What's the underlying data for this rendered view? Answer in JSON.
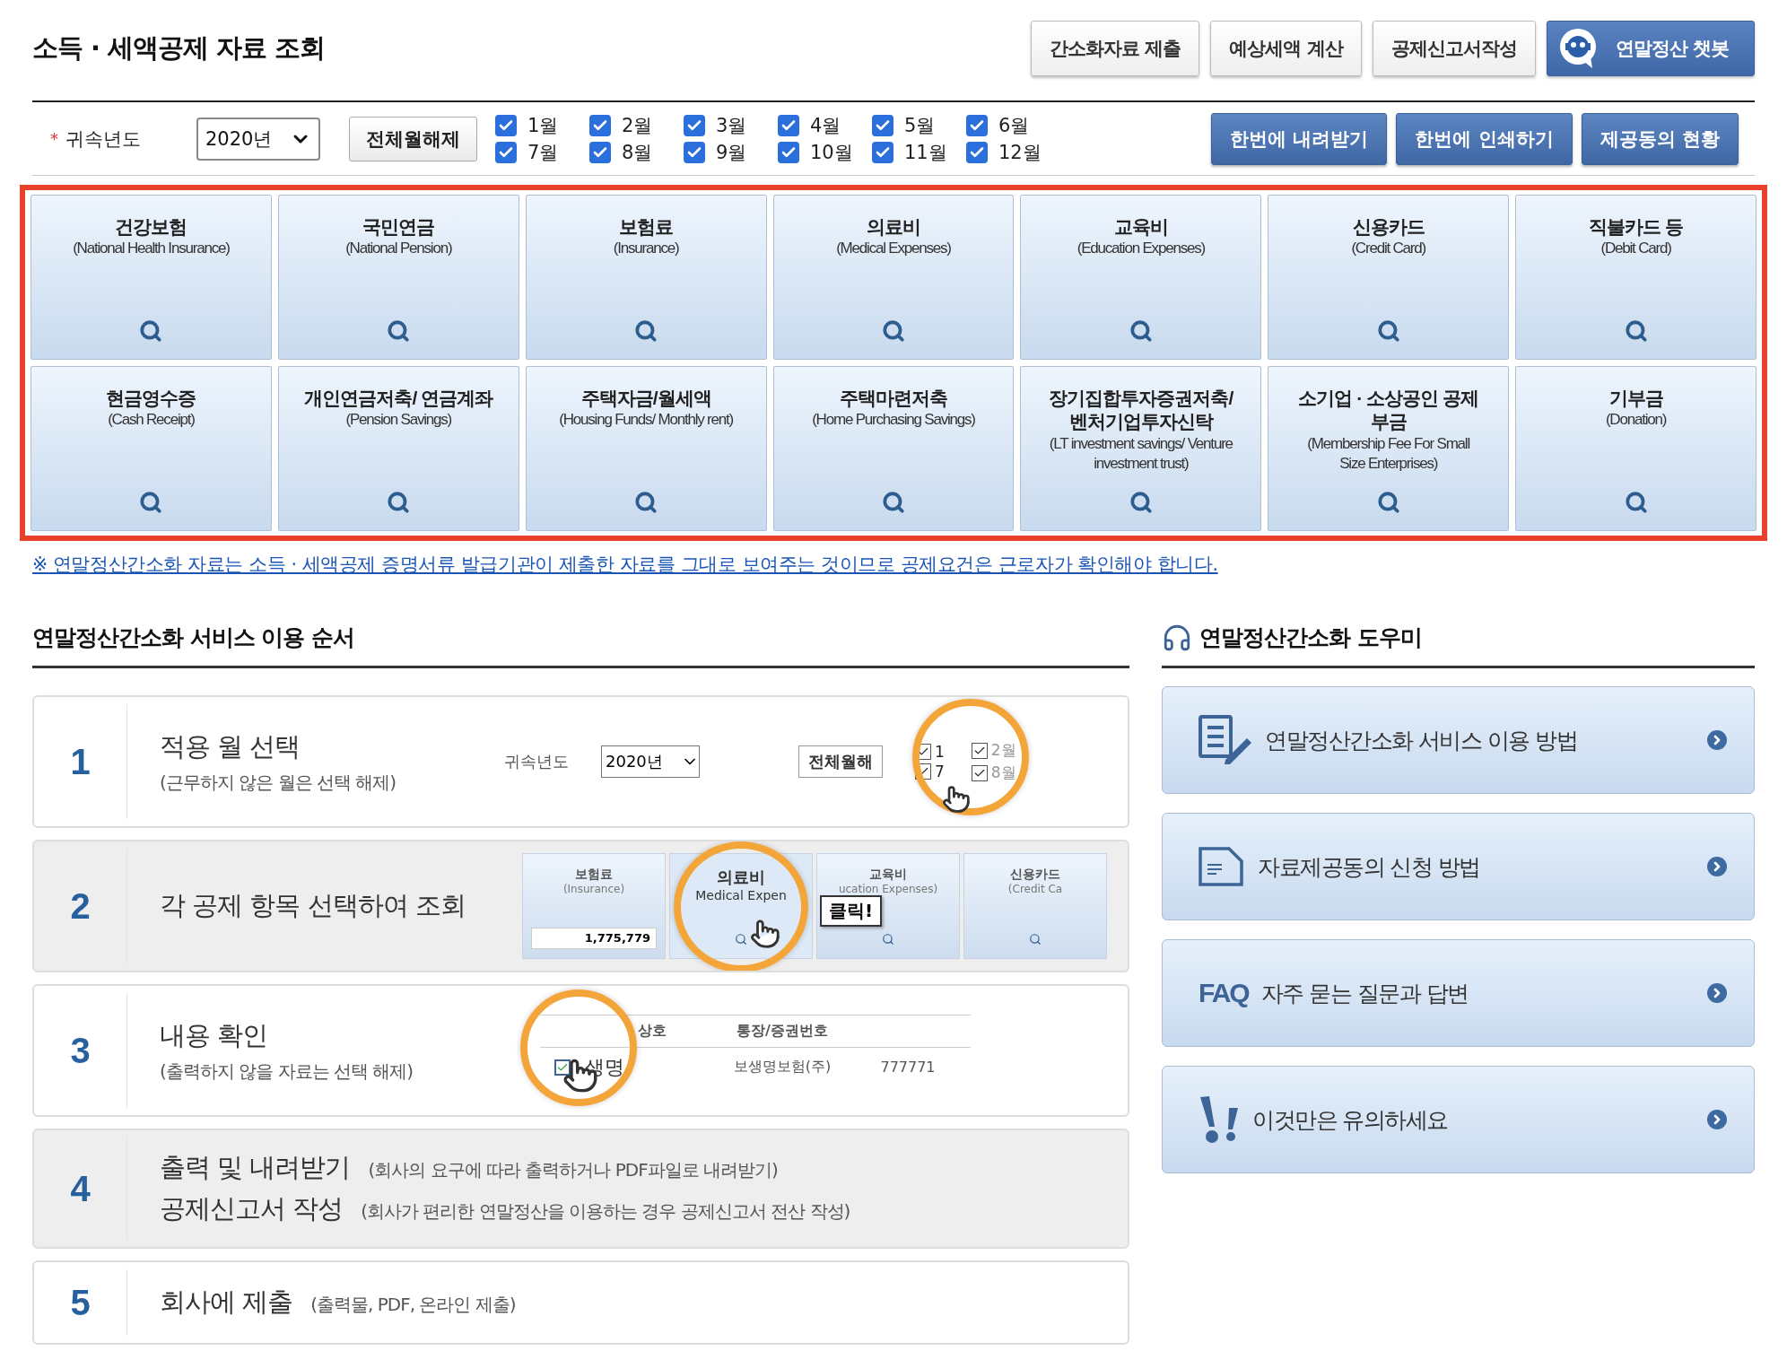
{
  "page_title": "소득 · 세액공제 자료 조회",
  "top_buttons": [
    {
      "label": "간소화자료 제출",
      "kind": "plain"
    },
    {
      "label": "예상세액 계산",
      "kind": "plain"
    },
    {
      "label": "공제신고서작성",
      "kind": "plain"
    },
    {
      "label": "연말정산 챗봇",
      "kind": "chatbot"
    }
  ],
  "filter": {
    "required_mark": "*",
    "year_label": "귀속년도",
    "year": "2020년",
    "clear_button": "전체월해제",
    "months": [
      {
        "label": "1월",
        "checked": true
      },
      {
        "label": "2월",
        "checked": true
      },
      {
        "label": "3월",
        "checked": true
      },
      {
        "label": "4월",
        "checked": true
      },
      {
        "label": "5월",
        "checked": true
      },
      {
        "label": "6월",
        "checked": true
      },
      {
        "label": "7월",
        "checked": true
      },
      {
        "label": "8월",
        "checked": true
      },
      {
        "label": "9월",
        "checked": true
      },
      {
        "label": "10월",
        "checked": true
      },
      {
        "label": "11월",
        "checked": true
      },
      {
        "label": "12월",
        "checked": true
      }
    ],
    "actions": [
      "한번에 내려받기",
      "한번에 인쇄하기",
      "제공동의 현황"
    ]
  },
  "categories": [
    {
      "name": "건강보험",
      "english": "(National Health Insurance)"
    },
    {
      "name": "국민연금",
      "english": "(National Pension)"
    },
    {
      "name": "보험료",
      "english": "(Insurance)"
    },
    {
      "name": "의료비",
      "english": "(Medical Expenses)"
    },
    {
      "name": "교육비",
      "english": "(Education Expenses)"
    },
    {
      "name": "신용카드",
      "english": "(Credit Card)"
    },
    {
      "name": "직불카드 등",
      "english": "(Debit Card)"
    },
    {
      "name": "현금영수증",
      "english": "(Cash Receipt)"
    },
    {
      "name": "개인연금저축/ 연금계좌",
      "english": "(Pension Savings)"
    },
    {
      "name": "주택자금/월세액",
      "english": "(Housing Funds/ Monthly rent)"
    },
    {
      "name": "주택마련저축",
      "english": "(Home Purchasing Savings)"
    },
    {
      "name": "장기집합투자증권저축/ 벤처기업투자신탁",
      "english": "(LT investment savings/ Venture investment trust)"
    },
    {
      "name": "소기업 · 소상공인 공제부금",
      "english": "(Membership Fee For Small Size Enterprises)"
    },
    {
      "name": "기부금",
      "english": "(Donation)"
    }
  ],
  "notice": "※ 연말정산간소화 자료는 소득 · 세액공제 증명서류 발급기관이 제출한 자료를 그대로 보여주는 것이므로 공제요건은 근로자가 확인해야 합니다.",
  "steps_section": {
    "title": "연말정산간소화 서비스 이용 순서",
    "steps": [
      {
        "number": "1",
        "shaded": false,
        "kind": "stacked",
        "lines": [
          {
            "title": "적용 월 선택",
            "note": "(근무하지 않은 월은 선택 해제)"
          }
        ],
        "illustration": {
          "kind": "month_select",
          "year_label": "귀속년도",
          "year": "2020년",
          "button": "전체월해",
          "zoomed": [
            {
              "label": "1",
              "checked": true
            },
            {
              "label": "7",
              "checked": true
            }
          ],
          "months": [
            {
              "label": "2월",
              "checked": true
            },
            {
              "label": "8월",
              "checked": true
            }
          ]
        }
      },
      {
        "number": "2",
        "shaded": true,
        "kind": "stacked",
        "lines": [
          {
            "title": "각 공제 항목 선택하여 조회"
          }
        ],
        "illustration": {
          "kind": "tiles",
          "callout": "클릭!",
          "tiles": [
            {
              "name": "보험료",
              "english": "(Insurance)",
              "amount": "1,775,779",
              "highlight": false
            },
            {
              "name": "의료비",
              "english": "Medical Expen",
              "highlight": true
            },
            {
              "name": "교육비",
              "english": "ucation Expenses)",
              "highlight": false
            },
            {
              "name": "신용카드",
              "english": "(Credit Ca",
              "highlight": false
            }
          ]
        }
      },
      {
        "number": "3",
        "shaded": false,
        "kind": "stacked",
        "lines": [
          {
            "title": "내용 확인",
            "note": "(출력하지 않을 자료는 선택 해제)"
          }
        ],
        "illustration": {
          "kind": "table",
          "columns": [
            "상호",
            "통장/증권번호"
          ],
          "rows": [
            {
              "checked": true,
              "cells": [
                "생명",
                "보생명보험(주)",
                "777771"
              ]
            }
          ]
        }
      },
      {
        "number": "4",
        "shaded": true,
        "kind": "inline",
        "lines": [
          {
            "title": "출력 및 내려받기",
            "note": "(회사의 요구에 따라 출력하거나 PDF파일로 내려받기)"
          },
          {
            "title": "공제신고서 작성",
            "note": "(회사가 편리한 연말정산을 이용하는 경우 공제신고서 전산 작성)"
          }
        ]
      },
      {
        "number": "5",
        "shaded": false,
        "kind": "inline",
        "lines": [
          {
            "title": "회사에 제출",
            "note": "(출력물, PDF, 온라인 제출)"
          }
        ]
      }
    ]
  },
  "helper": {
    "title": "연말정산간소화 도우미",
    "items": [
      {
        "label": "연말정산간소화 서비스 이용 방법",
        "kind": "guide"
      },
      {
        "label": "자료제공동의 신청 방법",
        "kind": "document"
      },
      {
        "label": "자주 묻는 질문과 답변",
        "kind": "faq",
        "badge": "FAQ"
      },
      {
        "label": "이것만은 유의하세요",
        "kind": "warning"
      }
    ]
  }
}
